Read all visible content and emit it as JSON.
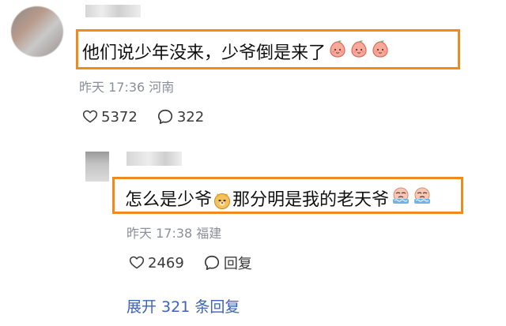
{
  "top_comment": {
    "text": "他们说少年没来，少爷倒是来了",
    "emojis": [
      "peach-face-emoji",
      "peach-face-emoji",
      "peach-face-emoji"
    ],
    "timestamp": "昨天 17:36",
    "location": "河南",
    "likes": "5372",
    "replies": "322"
  },
  "reply": {
    "text_before": "怎么是少爷",
    "text_after": "那分明是我的老天爷",
    "emojis": [
      "doge-emoji",
      "crying-face-emoji",
      "crying-face-emoji"
    ],
    "timestamp": "昨天 17:38",
    "location": "福建",
    "likes": "2469",
    "reply_label": "回复"
  },
  "expand": {
    "label": "展开 321 条回复"
  },
  "colors": {
    "highlight_border": "#f08a1c",
    "link_blue": "#3d63b8",
    "meta_gray": "#8a8f99"
  }
}
